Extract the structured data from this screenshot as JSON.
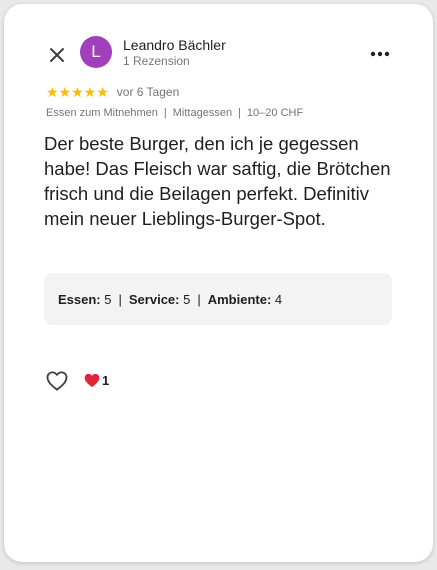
{
  "header": {
    "close_icon": "close-icon",
    "more_icon": "more-vert-icon"
  },
  "user": {
    "avatar_letter": "L",
    "avatar_color": "#a13fbd",
    "name": "Leandro Bächler",
    "review_count": "1 Rezension"
  },
  "review": {
    "stars": "★★★★★",
    "rating": 5,
    "star_color": "#fbbc04",
    "time": "vor 6 Tagen",
    "meta": [
      "Essen zum Mitnehmen",
      "Mittagessen",
      "10–20 CHF"
    ],
    "text": "Der beste Burger, den ich je gegessen habe! Das Fleisch war saftig, die Brötchen frisch und die Beilagen perfekt. Definitiv mein neuer Lieblings-Burger-Spot."
  },
  "subratings": [
    {
      "label": "Essen:",
      "value": "5"
    },
    {
      "label": "Service:",
      "value": "5"
    },
    {
      "label": "Ambiente:",
      "value": "4"
    }
  ],
  "reactions": {
    "like_icon": "heart-outline-icon",
    "reaction_icon": "heart-filled-icon",
    "reaction_color": "#e2243a",
    "count": "1"
  }
}
